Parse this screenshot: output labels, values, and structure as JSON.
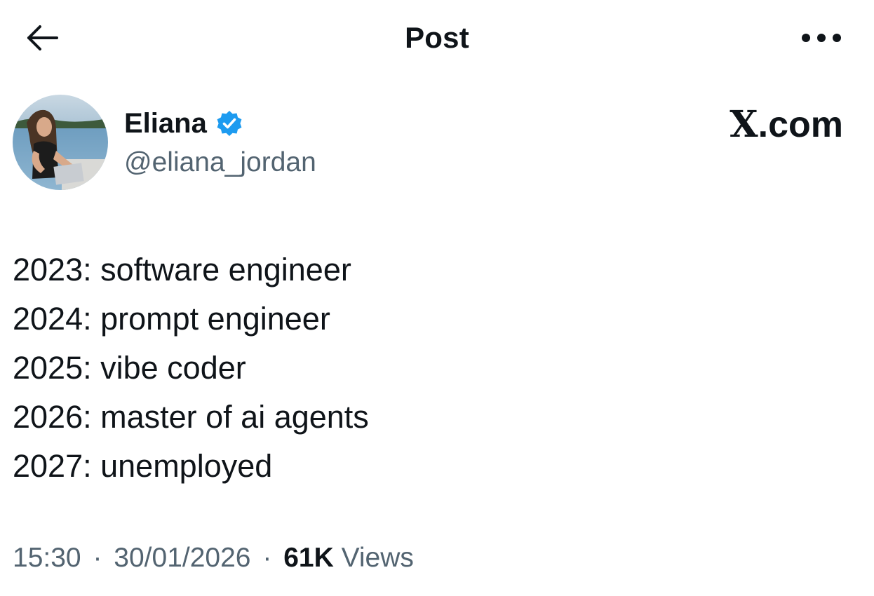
{
  "header": {
    "title": "Post",
    "back_icon": "arrow-left-icon",
    "more_icon": "more-horizontal-icon"
  },
  "author": {
    "display_name": "Eliana",
    "handle": "@eliana_jordan",
    "verified": true,
    "verified_color": "#1d9bf0"
  },
  "watermark": {
    "x_letter": "X",
    "suffix": ".com"
  },
  "post": {
    "lines": [
      "2023: software engineer",
      "2024: prompt engineer",
      "2025: vibe coder",
      "2026: master of ai agents",
      "2027: unemployed"
    ]
  },
  "meta": {
    "time": "15:30",
    "date": "30/01/2026",
    "separator": "·",
    "views_count": "61K",
    "views_label": "Views"
  },
  "colors": {
    "text_primary": "#0f1419",
    "text_secondary": "#536471",
    "background": "#ffffff"
  }
}
